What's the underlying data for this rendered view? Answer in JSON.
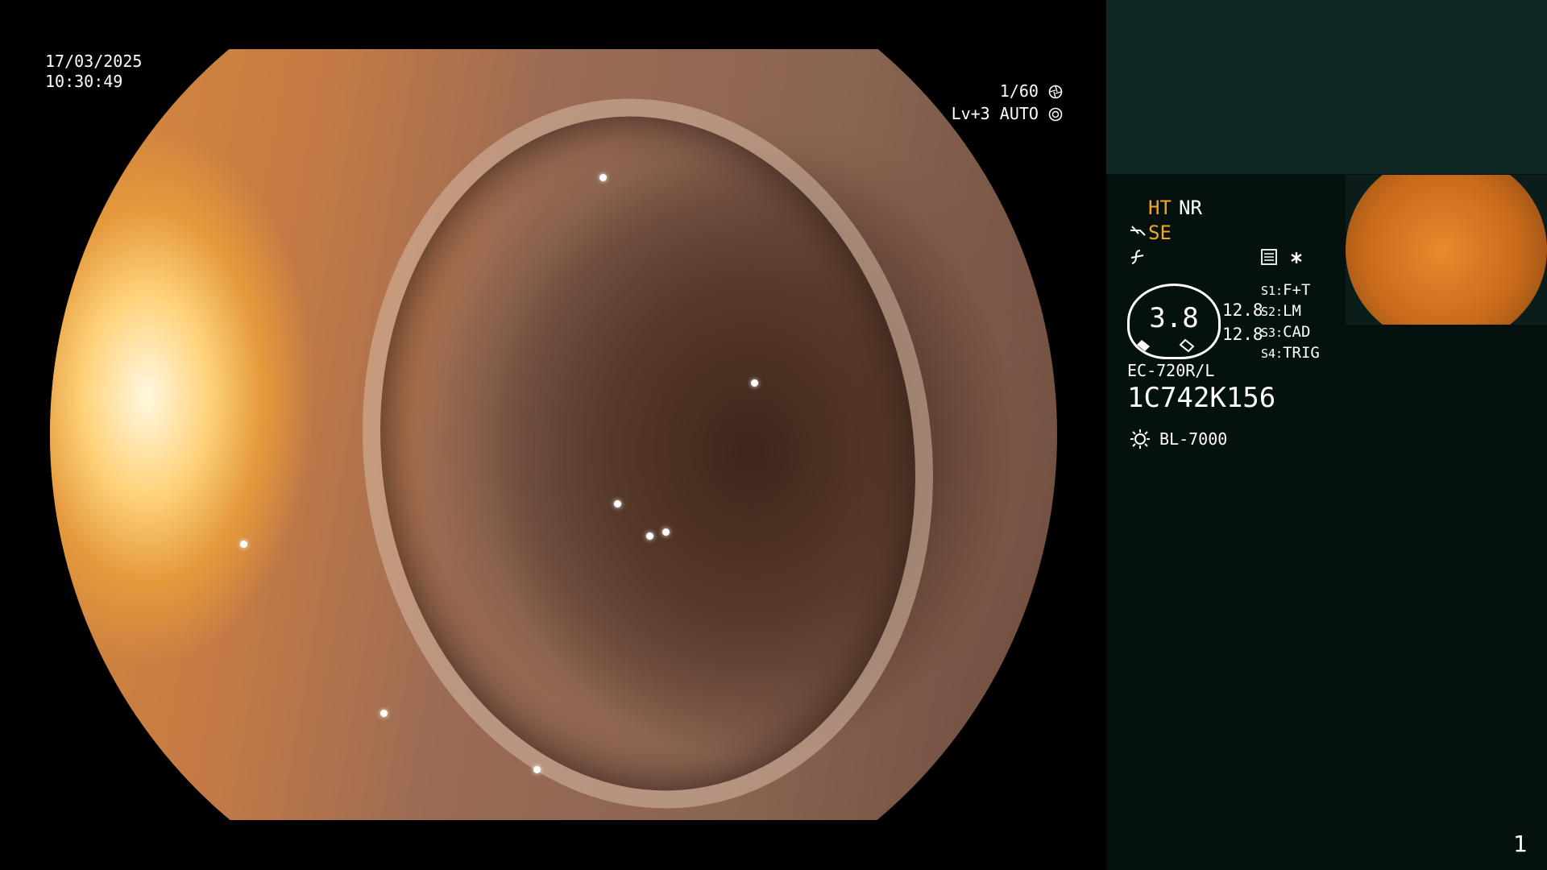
{
  "overlay": {
    "date": "17/03/2025",
    "time": "10:30:49",
    "shutter": "1/60",
    "level": "Lv+3",
    "iris_mode": "AUTO"
  },
  "panel": {
    "ht": "HT",
    "nr": "NR",
    "se": "SE",
    "gauge_value": "3.8",
    "gauge_side_1": "12.8",
    "gauge_side_2": "12.8",
    "settings": [
      {
        "key": "S1:",
        "value": "F+T"
      },
      {
        "key": "S2:",
        "value": "LM"
      },
      {
        "key": "S3:",
        "value": "CAD"
      },
      {
        "key": "S4:",
        "value": "TRIG"
      }
    ],
    "scope_model": "EC-720R/L",
    "scope_serial": "1C742K156",
    "light_source": "BL-7000",
    "page_number": "1"
  },
  "colors": {
    "accent_orange": "#f5a623",
    "panel_top": "#0f2825",
    "panel_bottom": "#05110f"
  },
  "icons": [
    "shutter-icon",
    "iris-icon",
    "pen-icon",
    "function-icon",
    "settings-card-icon",
    "asterisk-icon",
    "light-source-icon"
  ]
}
